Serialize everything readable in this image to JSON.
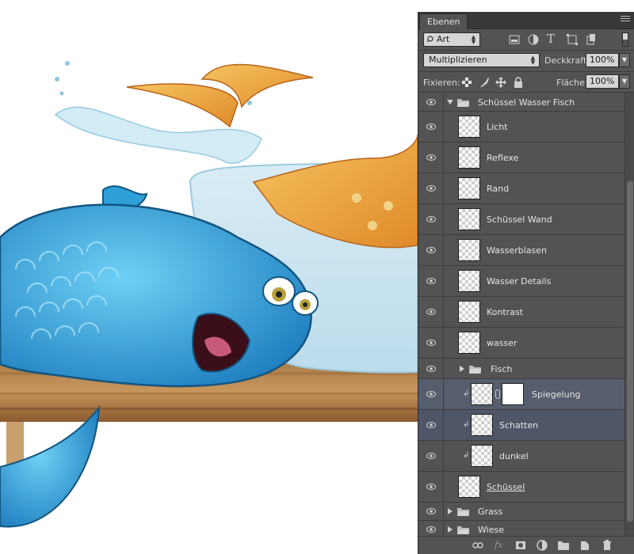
{
  "panel": {
    "tab_label": "Ebenen",
    "filter": {
      "value": "Art"
    },
    "blend_mode": "Multiplizieren",
    "opacity_label": "Deckkraft:",
    "opacity_value": "100%",
    "lock_label": "Fixieren:",
    "fill_label": "Fläche:",
    "fill_value": "100%"
  },
  "layers": [
    {
      "name": "Schüssel Wasser Fisch",
      "kind": "group-open"
    },
    {
      "name": "Licht",
      "kind": "layer"
    },
    {
      "name": "Reflexe",
      "kind": "layer"
    },
    {
      "name": "Rand",
      "kind": "layer"
    },
    {
      "name": "Schüssel Wand",
      "kind": "layer"
    },
    {
      "name": "Wasserblasen",
      "kind": "layer"
    },
    {
      "name": "Wasser Details",
      "kind": "layer"
    },
    {
      "name": "Kontrast",
      "kind": "layer"
    },
    {
      "name": "wasser",
      "kind": "layer"
    },
    {
      "name": "Fisch",
      "kind": "group-closed"
    },
    {
      "name": "Spiegelung",
      "kind": "clipped-masked",
      "selected": true
    },
    {
      "name": "Schatten",
      "kind": "clipped",
      "selected": true
    },
    {
      "name": "dunkel",
      "kind": "clipped"
    },
    {
      "name": "Schüssel",
      "kind": "layer"
    },
    {
      "name": "Grass",
      "kind": "group-closed"
    },
    {
      "name": "Wiese",
      "kind": "group-closed"
    }
  ],
  "colors": {
    "panel_bg": "#535353",
    "selection": "#565d6c",
    "fish_blue": "#2f9fd8",
    "goldfish_orange": "#e89a3a"
  }
}
